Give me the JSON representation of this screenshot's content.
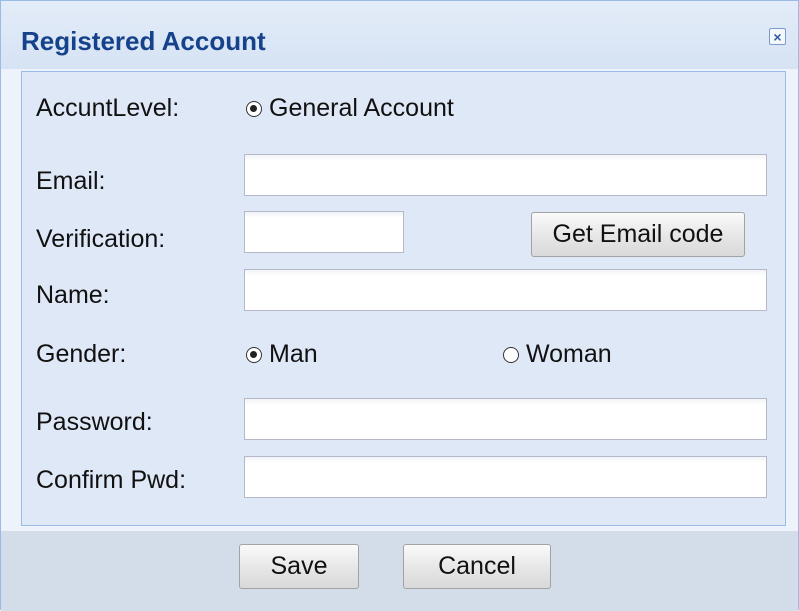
{
  "dialog": {
    "title": "Registered Account",
    "close_glyph": "×",
    "close_icon": "close-icon"
  },
  "form": {
    "account_level": {
      "label": "AccuntLevel:",
      "option": "General Account",
      "selected": true
    },
    "email": {
      "label": "Email:",
      "value": ""
    },
    "verification": {
      "label": "Verification:",
      "value": "",
      "button": "Get Email code"
    },
    "name": {
      "label": "Name:",
      "value": ""
    },
    "gender": {
      "label": "Gender:",
      "options": [
        {
          "label": "Man",
          "selected": true
        },
        {
          "label": "Woman",
          "selected": false
        }
      ]
    },
    "password": {
      "label": "Password:",
      "value": ""
    },
    "confirm_pwd": {
      "label": "Confirm Pwd:",
      "value": ""
    }
  },
  "footer": {
    "save_label": "Save",
    "cancel_label": "Cancel"
  },
  "colors": {
    "title_text": "#15428b",
    "panel_bg": "#dfe8f6",
    "border": "#99bbe8"
  }
}
